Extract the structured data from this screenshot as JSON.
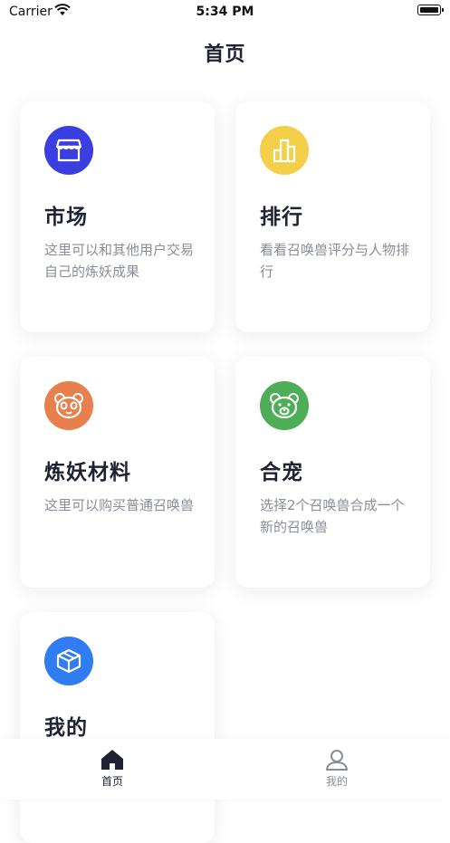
{
  "status_bar": {
    "carrier": "Carrier",
    "time": "5:34 PM"
  },
  "nav": {
    "title": "首页"
  },
  "cards": [
    {
      "title": "市场",
      "desc": "这里可以和其他用户交易自己的炼妖成果",
      "icon": "shop-icon",
      "color": "#3b3fe0"
    },
    {
      "title": "排行",
      "desc": "看看召唤兽评分与人物排行",
      "icon": "bar-chart-icon",
      "color": "#f4cf4a"
    },
    {
      "title": "炼妖材料",
      "desc": "这里可以购买普通召唤兽",
      "icon": "panda-icon",
      "color": "#e8804e"
    },
    {
      "title": "合宠",
      "desc": "选择2个召唤兽合成一个新的召唤兽",
      "icon": "bear-icon",
      "color": "#4eae58"
    },
    {
      "title": "我的",
      "desc": "",
      "icon": "box-icon",
      "color": "#2f7cf3"
    }
  ],
  "tabbar": {
    "home_label": "首页",
    "mine_label": "我的",
    "active_color": "#1f2233",
    "inactive_color": "#8a8d99"
  }
}
